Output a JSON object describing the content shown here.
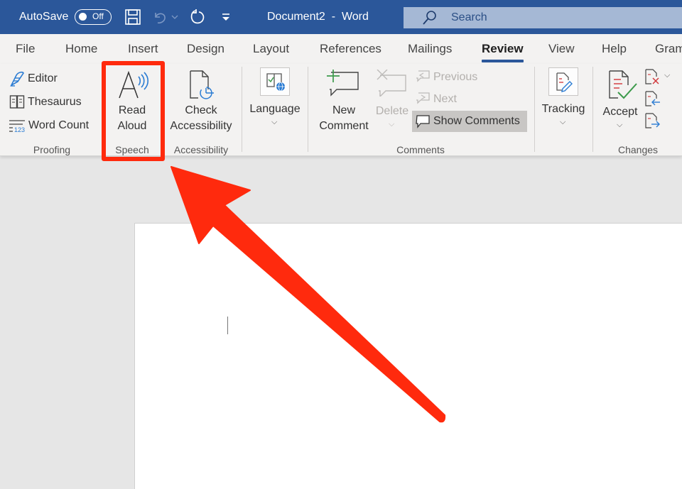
{
  "titlebar": {
    "autosave_label": "AutoSave",
    "autosave_state": "Off",
    "document_name": "Document2",
    "separator": "-",
    "app_name": "Word",
    "search_placeholder": "Search",
    "icons": [
      "save-icon",
      "undo-icon",
      "undo-dropdown-icon",
      "redo-icon",
      "customize-quick-access-icon",
      "search-icon"
    ]
  },
  "tabs": [
    {
      "label": "File",
      "active": false
    },
    {
      "label": "Home",
      "active": false
    },
    {
      "label": "Insert",
      "active": false
    },
    {
      "label": "Design",
      "active": false
    },
    {
      "label": "Layout",
      "active": false
    },
    {
      "label": "References",
      "active": false
    },
    {
      "label": "Mailings",
      "active": false
    },
    {
      "label": "Review",
      "active": true
    },
    {
      "label": "View",
      "active": false
    },
    {
      "label": "Help",
      "active": false
    },
    {
      "label": "Gram",
      "active": false
    }
  ],
  "ribbon": {
    "proofing": {
      "label": "Proofing",
      "items": [
        {
          "label": "Editor",
          "icon": "editor-pen-icon"
        },
        {
          "label": "Thesaurus",
          "icon": "thesaurus-book-icon"
        },
        {
          "label": "Word Count",
          "icon": "word-count-icon"
        }
      ]
    },
    "speech": {
      "label": "Speech",
      "read_aloud_line1": "Read",
      "read_aloud_line2": "Aloud",
      "icon": "read-aloud-icon"
    },
    "accessibility": {
      "label": "Accessibility",
      "check_line1": "Check",
      "check_line2": "Accessibility",
      "icon": "check-accessibility-icon"
    },
    "language": {
      "label": "Language",
      "icon": "language-icon"
    },
    "comments": {
      "label": "Comments",
      "new_line1": "New",
      "new_line2": "Comment",
      "delete_label": "Delete",
      "previous_label": "Previous",
      "next_label": "Next",
      "show_comments_label": "Show Comments"
    },
    "tracking": {
      "label": "Tracking",
      "icon": "tracking-icon"
    },
    "changes": {
      "label": "Changes",
      "accept_label": "Accept",
      "icons": [
        "reject-icon",
        "previous-change-icon",
        "next-change-icon"
      ]
    }
  },
  "annotation": {
    "highlight": "Read Aloud / Speech group",
    "color": "#ff2a0d"
  },
  "colors": {
    "title_bar": "#2b579a",
    "ribbon_bg": "#f3f2f1",
    "canvas_bg": "#e6e6e6",
    "accent": "#2b579a"
  }
}
